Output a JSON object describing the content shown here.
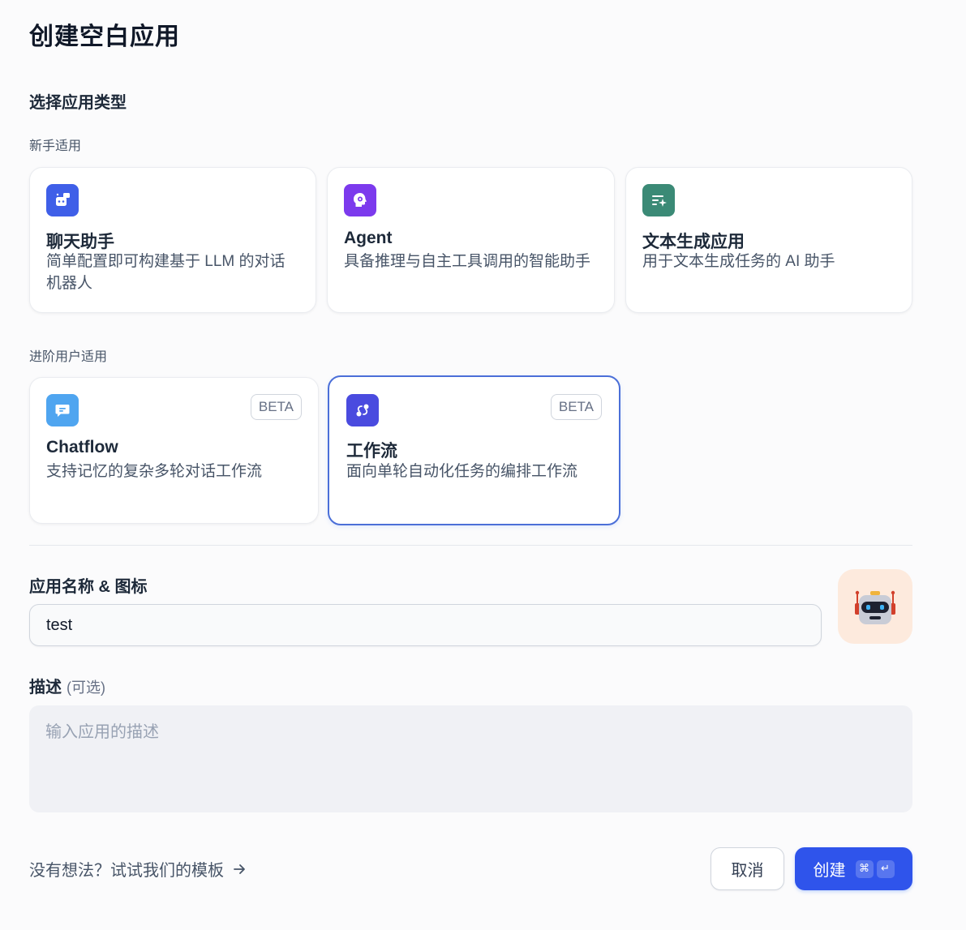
{
  "header": {
    "title": "创建空白应用"
  },
  "app_type": {
    "section_title": "选择应用类型",
    "beginner_label": "新手适用",
    "advanced_label": "进阶用户适用",
    "beginner_cards": [
      {
        "title": "聊天助手",
        "desc": "简单配置即可构建基于 LLM 的对话机器人",
        "icon": "chat-bot-icon",
        "color": "#3f5fe8"
      },
      {
        "title": "Agent",
        "desc": "具备推理与自主工具调用的智能助手",
        "icon": "agent-brain-icon",
        "color": "#7c3aed"
      },
      {
        "title": "文本生成应用",
        "desc": "用于文本生成任务的 AI 助手",
        "icon": "text-sparkle-icon",
        "color": "#3b8a76"
      }
    ],
    "advanced_cards": [
      {
        "title": "Chatflow",
        "desc": "支持记忆的复杂多轮对话工作流",
        "badge": "BETA",
        "icon": "chat-bubble-icon",
        "color": "#4fa5f0"
      },
      {
        "title": "工作流",
        "desc": "面向单轮自动化任务的编排工作流",
        "badge": "BETA",
        "icon": "workflow-nodes-icon",
        "color": "#4a4bdf"
      }
    ],
    "selected": "工作流"
  },
  "form": {
    "name_label": "应用名称 & 图标",
    "name_value": "test",
    "avatar_icon": "robot-emoji-icon",
    "avatar_bg": "#fdeadd",
    "desc_label": "描述",
    "desc_optional": "(可选)",
    "desc_placeholder": "输入应用的描述"
  },
  "footer": {
    "template_link": "没有想法？试试我们的模板",
    "cancel_label": "取消",
    "create_label": "创建",
    "shortcut_cmd": "⌘",
    "shortcut_enter": "↵"
  }
}
